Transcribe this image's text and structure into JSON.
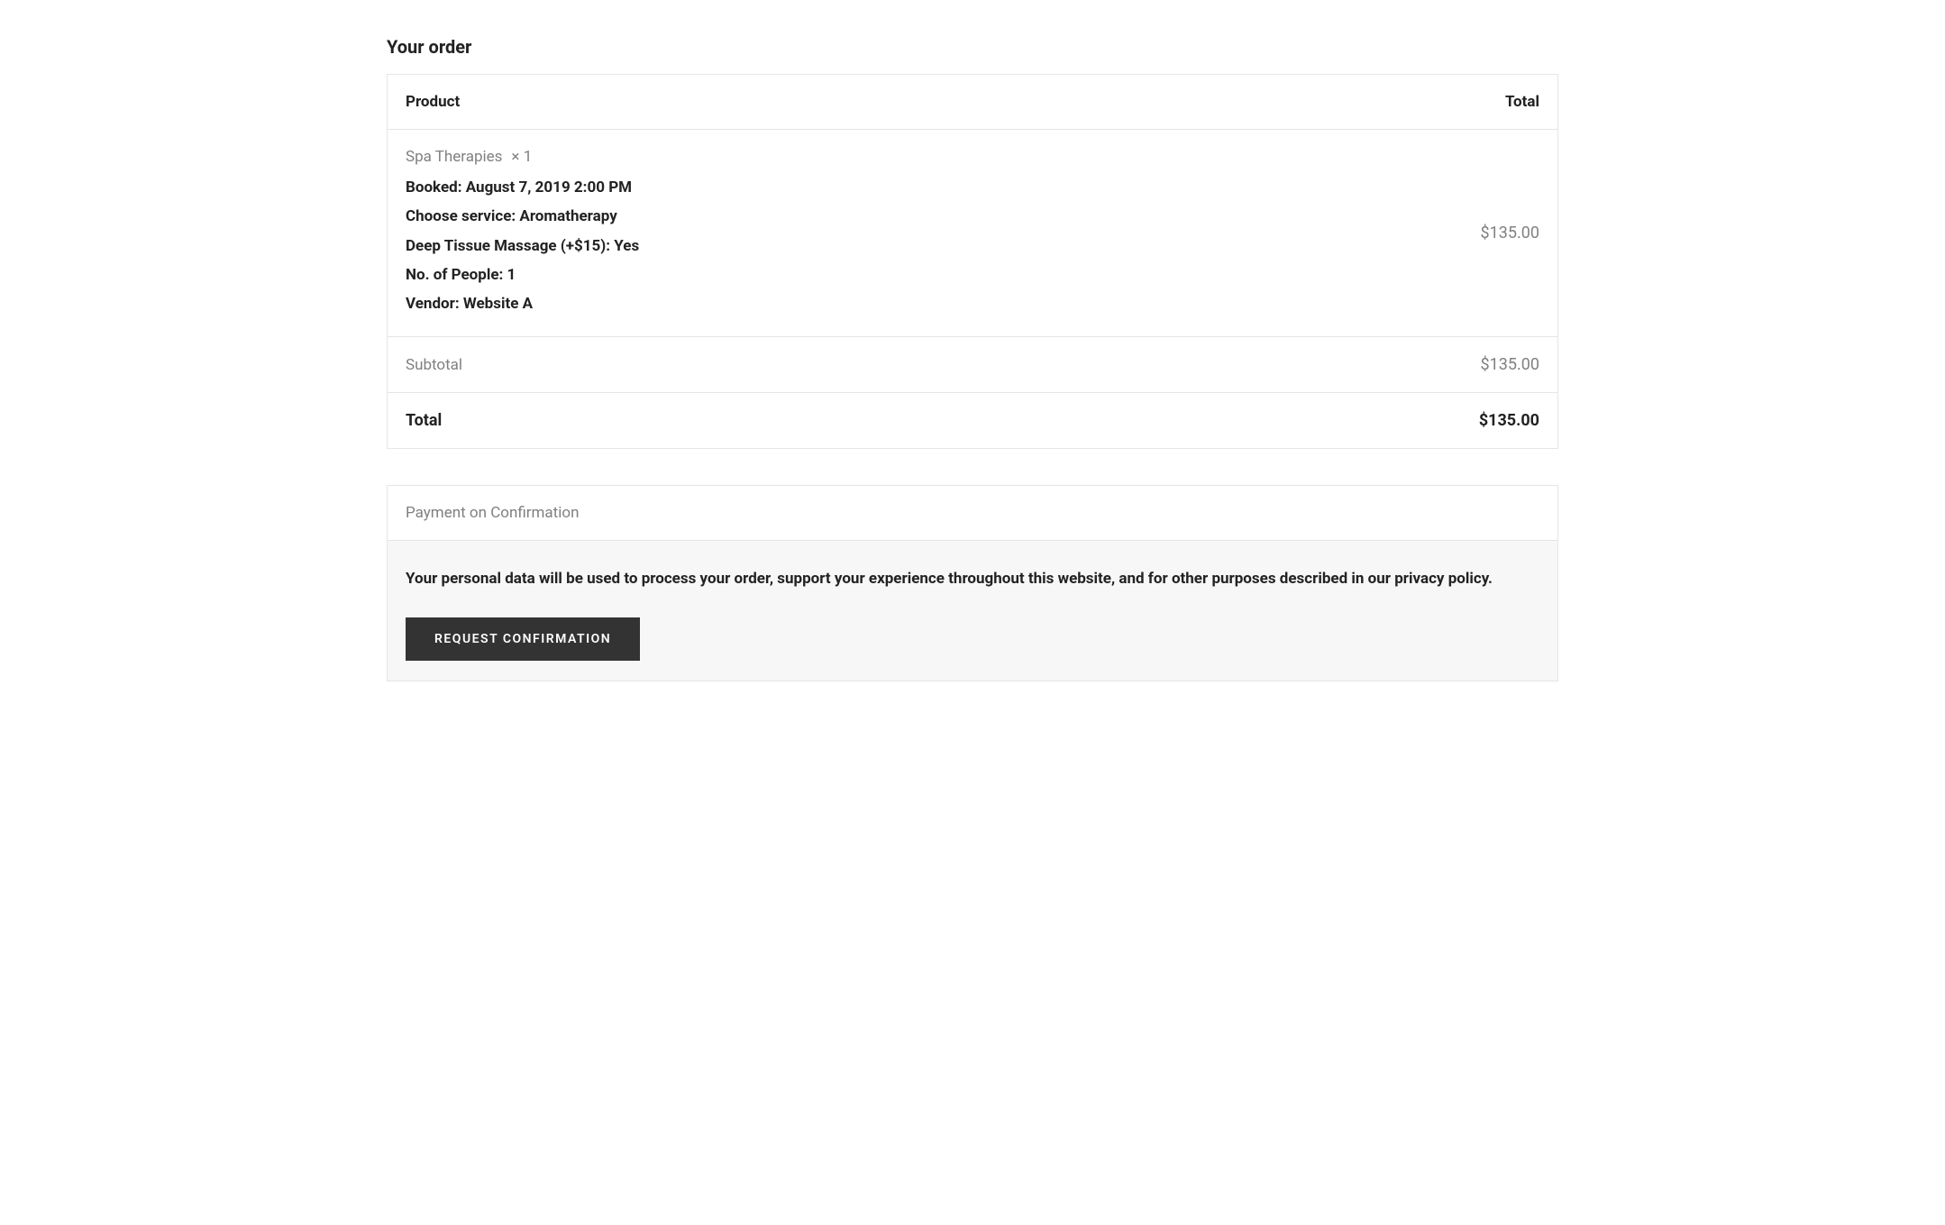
{
  "heading": "Your order",
  "table": {
    "headers": {
      "product": "Product",
      "total": "Total"
    },
    "item": {
      "name": "Spa Therapies",
      "quantity": "× 1",
      "details": {
        "booked": "Booked: August 7, 2019 2:00 PM",
        "service": "Choose service: Aromatherapy",
        "addon": "Deep Tissue Massage (+$15): Yes",
        "people": "No. of People: 1",
        "vendor": "Vendor: Website A"
      },
      "price": "$135.00"
    },
    "subtotal": {
      "label": "Subtotal",
      "value": "$135.00"
    },
    "total": {
      "label": "Total",
      "value": "$135.00"
    }
  },
  "payment": {
    "method": "Payment on Confirmation",
    "privacy_text": "Your personal data will be used to process your order, support your experience throughout this website, and for other purposes described in our privacy policy.",
    "button_label": "Request Confirmation"
  }
}
